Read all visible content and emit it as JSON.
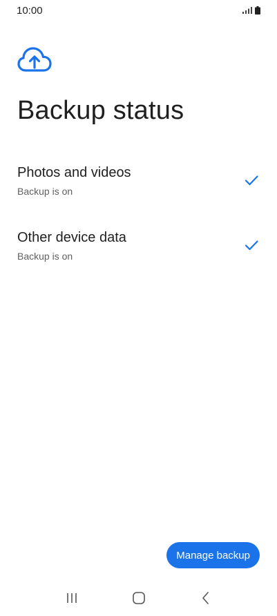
{
  "status_bar": {
    "time": "10:00",
    "signal_icon": "signal-icon",
    "battery_icon": "battery-icon"
  },
  "header": {
    "icon": "cloud-upload-icon",
    "title": "Backup status"
  },
  "items": [
    {
      "title": "Photos and videos",
      "subtitle": "Backup is on",
      "icon": "check-icon"
    },
    {
      "title": "Other device data",
      "subtitle": "Backup is on",
      "icon": "check-icon"
    }
  ],
  "actions": {
    "manage_label": "Manage backup"
  },
  "nav_bar": {
    "recents_icon": "recents-icon",
    "home_icon": "home-icon",
    "back_icon": "back-icon"
  },
  "colors": {
    "accent": "#1a73e8",
    "text_primary": "#1f1f1f",
    "text_secondary": "#606060"
  }
}
